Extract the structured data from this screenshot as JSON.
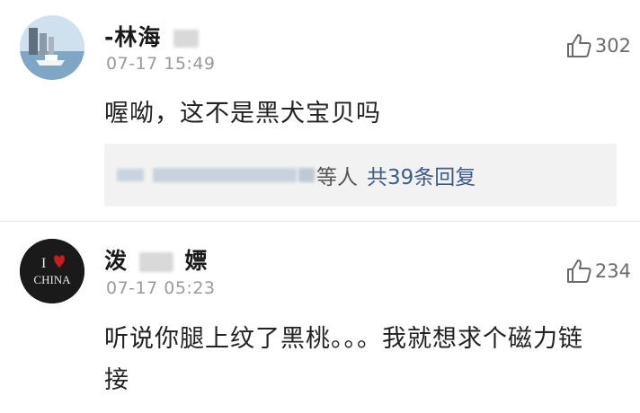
{
  "comments": [
    {
      "name": "-林海",
      "time": "07-17 15:49",
      "likes": "302",
      "text": "喔呦，这不是黑犬宝贝吗",
      "replies": {
        "suffix": "等人",
        "count_label": "共39条回复"
      }
    },
    {
      "name_part1": "泼",
      "name_part2": "嫖",
      "time": "07-17 05:23",
      "likes": "234",
      "text": "听说你腿上纹了黑桃。。。我就想求个磁力链接",
      "avatar": {
        "top": "I",
        "bottom": "CHINA"
      }
    }
  ],
  "icons": {
    "like": "thumbs-up-icon"
  },
  "colors": {
    "link": "#3c5a8a",
    "time": "#9a9a9a",
    "avatar2_bg": "#1a1a1a",
    "heart": "#c41e1e"
  }
}
